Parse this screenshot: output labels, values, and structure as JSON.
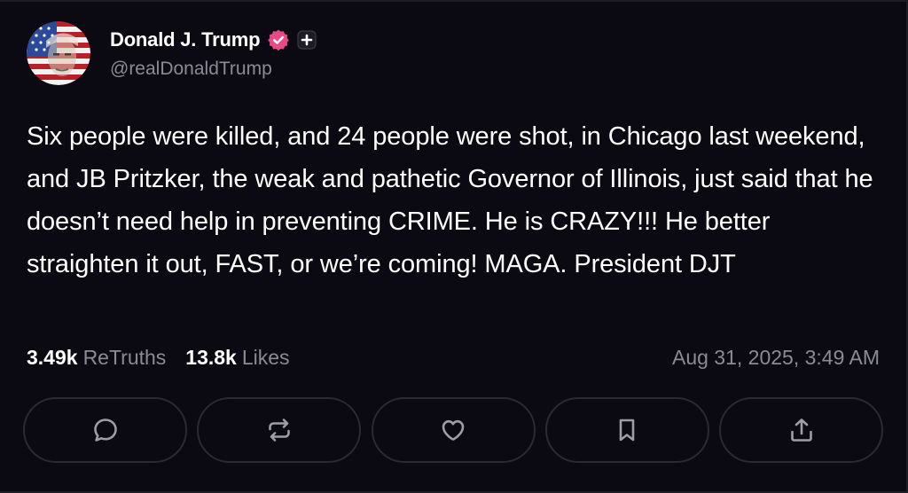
{
  "author": {
    "display_name": "Donald J. Trump",
    "handle": "@realDonaldTrump",
    "verified_icon": "verified-badge-icon",
    "badge_color": "#e94a85",
    "extra_icon": "plus-badge-icon"
  },
  "post": {
    "text": "Six people were killed, and 24 people were shot, in Chicago last weekend, and JB Pritzker, the weak and pathetic Governor of Illinois, just said that he doesn’t need help in preventing CRIME. He is CRAZY!!! He better straighten it out, FAST, or we’re coming! MAGA. President DJT"
  },
  "stats": {
    "retruths_count": "3.49k",
    "retruths_label": "ReTruths",
    "likes_count": "13.8k",
    "likes_label": "Likes",
    "timestamp": "Aug 31, 2025, 3:49 AM"
  },
  "actions": [
    {
      "name": "reply",
      "icon": "comment-icon"
    },
    {
      "name": "retruth",
      "icon": "repost-icon"
    },
    {
      "name": "like",
      "icon": "heart-icon"
    },
    {
      "name": "bookmark",
      "icon": "bookmark-icon"
    },
    {
      "name": "share",
      "icon": "share-icon"
    }
  ],
  "colors": {
    "background": "#0b0a12",
    "text_primary": "#ffffff",
    "text_secondary": "#8b8a97",
    "button_border": "#2a2935"
  }
}
